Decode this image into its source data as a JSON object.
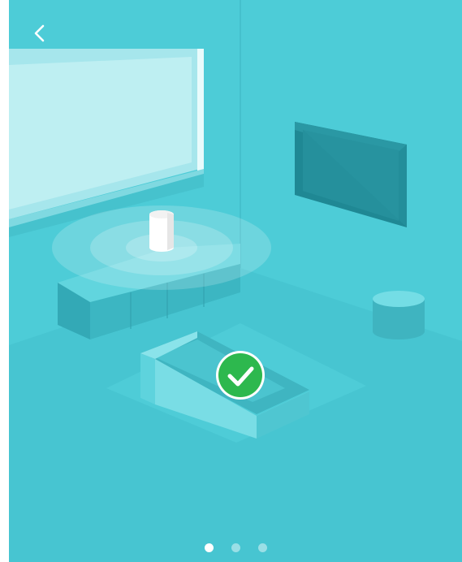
{
  "screen": {
    "background_color": "#4ccbd6",
    "back_icon": "chevron-left-icon",
    "status_icon": "check-circle-icon",
    "status_color": "#2db84e"
  },
  "pagination": {
    "total_pages": 3,
    "current_page": 1
  }
}
